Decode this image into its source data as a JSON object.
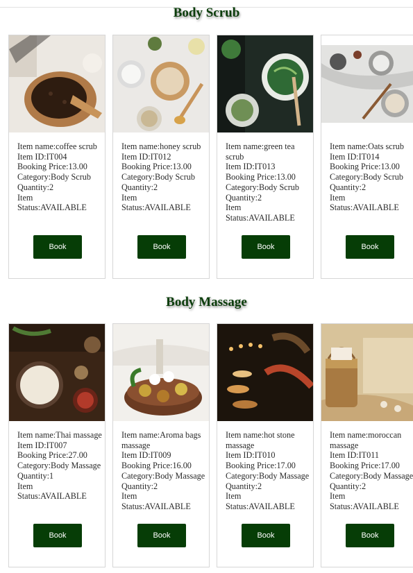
{
  "sections": [
    {
      "title": "Body Scrub",
      "items": [
        {
          "name_label": "Item name:coffee scrub",
          "id_label": "Item ID:IT004",
          "price_label": "Booking Price:13.00",
          "category_label": "Category:Body Scrub",
          "quantity_label": "Quantity:2",
          "status_label": "Item Status:AVAILABLE",
          "book_label": "Book"
        },
        {
          "name_label": "Item name:honey scrub",
          "id_label": "Item ID:IT012",
          "price_label": "Booking Price:13.00",
          "category_label": "Category:Body Scrub",
          "quantity_label": "Quantity:2",
          "status_label": "Item Status:AVAILABLE",
          "book_label": "Book"
        },
        {
          "name_label": "Item name:green tea scrub",
          "id_label": "Item ID:IT013",
          "price_label": "Booking Price:13.00",
          "category_label": "Category:Body Scrub",
          "quantity_label": "Quantity:2",
          "status_label": "Item Status:AVAILABLE",
          "book_label": "Book"
        },
        {
          "name_label": "Item name:Oats scrub",
          "id_label": "Item ID:IT014",
          "price_label": "Booking Price:13.00",
          "category_label": "Category:Body Scrub",
          "quantity_label": "Quantity:2",
          "status_label": "Item Status:AVAILABLE",
          "book_label": "Book"
        }
      ]
    },
    {
      "title": "Body Massage",
      "items": [
        {
          "name_label": "Item name:Thai massage",
          "id_label": "Item ID:IT007",
          "price_label": "Booking Price:27.00",
          "category_label": "Category:Body Massage",
          "quantity_label": "Quantity:1",
          "status_label": "Item Status:AVAILABLE",
          "book_label": "Book"
        },
        {
          "name_label": "Item name:Aroma bags massage",
          "id_label": "Item ID:IT009",
          "price_label": "Booking Price:16.00",
          "category_label": "Category:Body Massage",
          "quantity_label": "Quantity:2",
          "status_label": "Item Status:AVAILABLE",
          "book_label": "Book"
        },
        {
          "name_label": "Item name:hot stone massage",
          "id_label": "Item ID:IT010",
          "price_label": "Booking Price:17.00",
          "category_label": "Category:Body Massage",
          "quantity_label": "Quantity:2",
          "status_label": "Item Status:AVAILABLE",
          "book_label": "Book"
        },
        {
          "name_label": "Item name:moroccan massage",
          "id_label": "Item ID:IT011",
          "price_label": "Booking Price:17.00",
          "category_label": "Category:Body Massage",
          "quantity_label": "Quantity:2",
          "status_label": "Item Status:AVAILABLE",
          "book_label": "Book"
        }
      ]
    }
  ],
  "colors": {
    "accent": "#063d06",
    "title": "#0b3d0b",
    "card_border": "#d6d6d6"
  }
}
